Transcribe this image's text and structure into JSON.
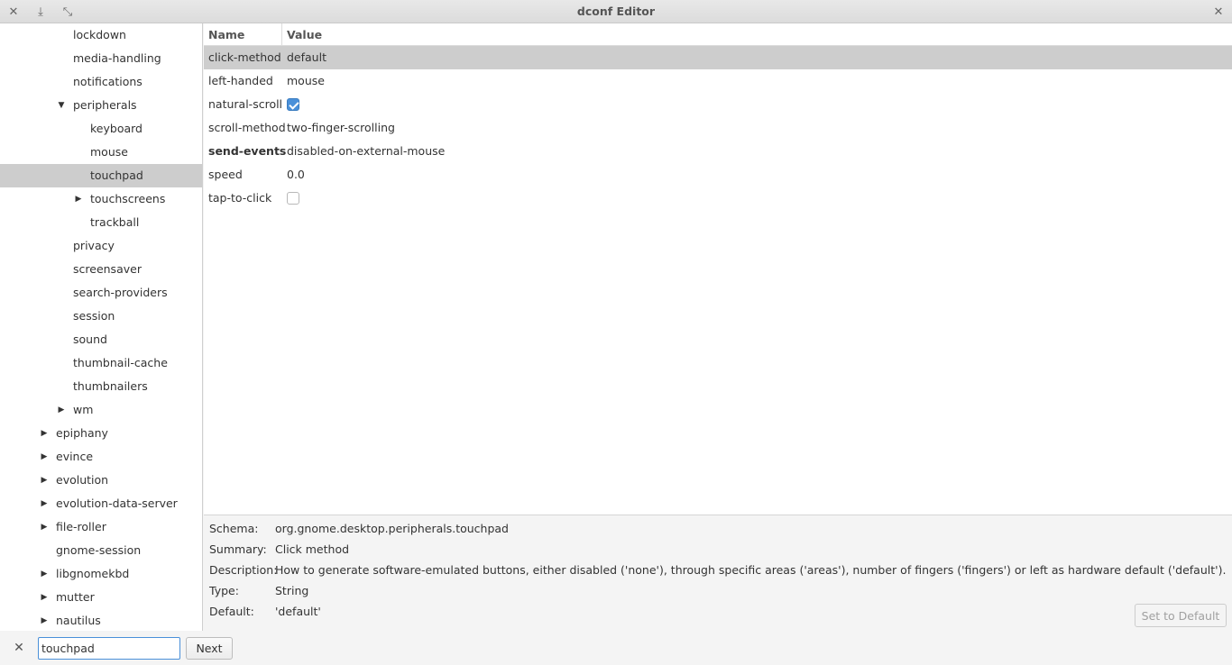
{
  "window": {
    "title": "dconf Editor",
    "icons": {
      "left": [
        "close-icon",
        "download-icon",
        "minimize-icon"
      ],
      "right": "close-icon"
    }
  },
  "sidebar": {
    "items": [
      {
        "label": "lockdown",
        "level": 2,
        "expander": "none"
      },
      {
        "label": "media-handling",
        "level": 2,
        "expander": "none"
      },
      {
        "label": "notifications",
        "level": 2,
        "expander": "none"
      },
      {
        "label": "peripherals",
        "level": 2,
        "expander": "expanded"
      },
      {
        "label": "keyboard",
        "level": 3,
        "expander": "none"
      },
      {
        "label": "mouse",
        "level": 3,
        "expander": "none"
      },
      {
        "label": "touchpad",
        "level": 3,
        "expander": "none",
        "selected": true
      },
      {
        "label": "touchscreens",
        "level": 3,
        "expander": "collapsed"
      },
      {
        "label": "trackball",
        "level": 3,
        "expander": "none"
      },
      {
        "label": "privacy",
        "level": 2,
        "expander": "none"
      },
      {
        "label": "screensaver",
        "level": 2,
        "expander": "none"
      },
      {
        "label": "search-providers",
        "level": 2,
        "expander": "none"
      },
      {
        "label": "session",
        "level": 2,
        "expander": "none"
      },
      {
        "label": "sound",
        "level": 2,
        "expander": "none"
      },
      {
        "label": "thumbnail-cache",
        "level": 2,
        "expander": "none"
      },
      {
        "label": "thumbnailers",
        "level": 2,
        "expander": "none"
      },
      {
        "label": "wm",
        "level": 2,
        "expander": "collapsed"
      },
      {
        "label": "epiphany",
        "level": 1,
        "expander": "collapsed"
      },
      {
        "label": "evince",
        "level": 1,
        "expander": "collapsed"
      },
      {
        "label": "evolution",
        "level": 1,
        "expander": "collapsed"
      },
      {
        "label": "evolution-data-server",
        "level": 1,
        "expander": "collapsed"
      },
      {
        "label": "file-roller",
        "level": 1,
        "expander": "collapsed"
      },
      {
        "label": "gnome-session",
        "level": 1,
        "expander": "none"
      },
      {
        "label": "libgnomekbd",
        "level": 1,
        "expander": "collapsed"
      },
      {
        "label": "mutter",
        "level": 1,
        "expander": "collapsed"
      },
      {
        "label": "nautilus",
        "level": 1,
        "expander": "collapsed"
      }
    ]
  },
  "keys_table": {
    "columns": [
      "Name",
      "Value"
    ],
    "rows": [
      {
        "name": "click-method",
        "value": "default",
        "type": "text",
        "selected": true
      },
      {
        "name": "left-handed",
        "value": "mouse",
        "type": "text"
      },
      {
        "name": "natural-scroll",
        "value": "true",
        "type": "checkbox",
        "checked": true
      },
      {
        "name": "scroll-method",
        "value": "two-finger-scrolling",
        "type": "text"
      },
      {
        "name": "send-events",
        "value": "disabled-on-external-mouse",
        "type": "text",
        "bold": true
      },
      {
        "name": "speed",
        "value": "0.0",
        "type": "text"
      },
      {
        "name": "tap-to-click",
        "value": "false",
        "type": "checkbox",
        "checked": false
      }
    ]
  },
  "details": {
    "schema_label": "Schema:",
    "schema": "org.gnome.desktop.peripherals.touchpad",
    "summary_label": "Summary:",
    "summary": "Click method",
    "description_label": "Description:",
    "description": "How to generate software-emulated buttons, either disabled ('none'), through specific areas ('areas'), number of fingers ('fingers') or left as hardware default ('default').",
    "type_label": "Type:",
    "type": "String",
    "default_label": "Default:",
    "default": "'default'",
    "set_default_label": "Set to Default"
  },
  "search": {
    "value": "touchpad",
    "next_label": "Next"
  },
  "colors": {
    "selection": "#cdcdcd",
    "accent": "#4a90d9"
  }
}
